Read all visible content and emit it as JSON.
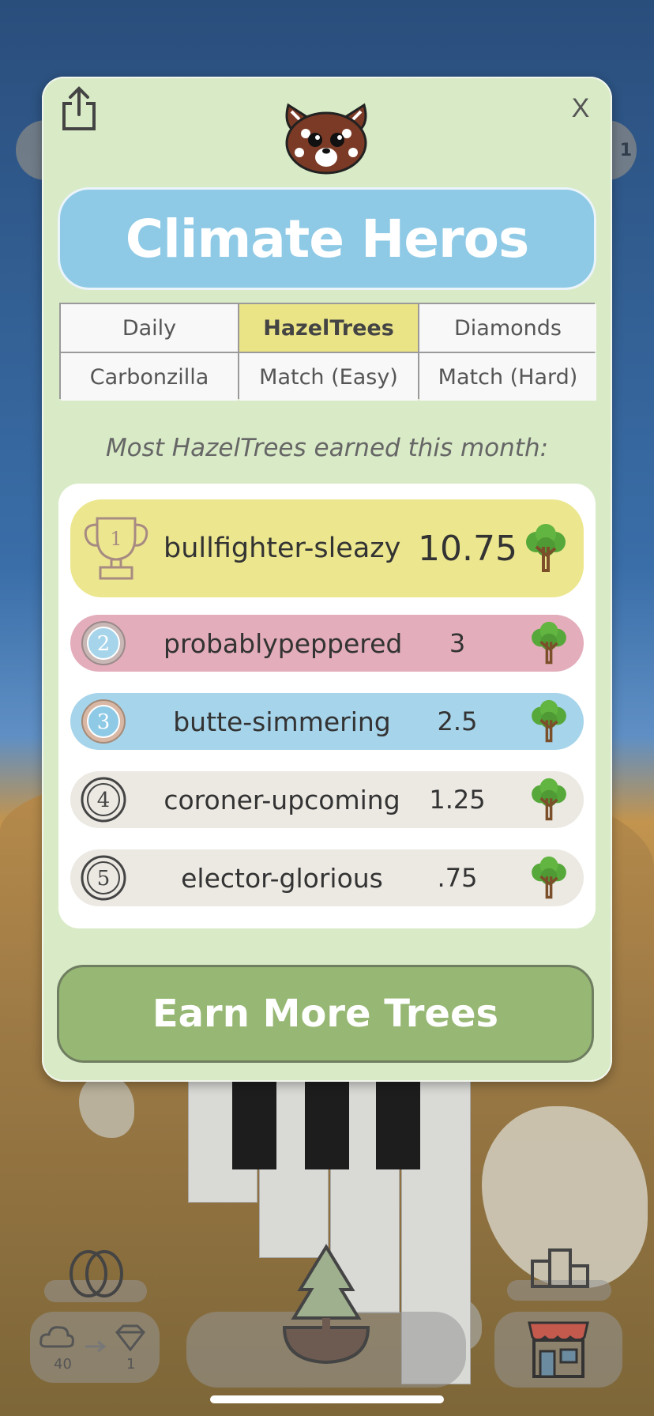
{
  "modal": {
    "title": "Climate Heros",
    "close_label": "X",
    "subtitle": "Most HazelTrees earned this month:",
    "tabs": [
      {
        "label": "Daily",
        "active": false
      },
      {
        "label": "HazelTrees",
        "active": true
      },
      {
        "label": "Diamonds",
        "active": false
      },
      {
        "label": "Carbonzilla",
        "active": false
      },
      {
        "label": "Match (Easy)",
        "active": false
      },
      {
        "label": "Match (Hard)",
        "active": false
      }
    ],
    "leaderboard": [
      {
        "rank": "1",
        "name": "bullfighter-sleazy",
        "score": "10.75"
      },
      {
        "rank": "2",
        "name": "probablypeppered",
        "score": "3"
      },
      {
        "rank": "3",
        "name": "butte-simmering",
        "score": "2.5"
      },
      {
        "rank": "4",
        "name": "coroner-upcoming",
        "score": "1.25"
      },
      {
        "rank": "5",
        "name": "elector-glorious",
        "score": ".75"
      }
    ],
    "cta_label": "Earn More Trees"
  },
  "background": {
    "side_badge_number": "1",
    "exchange": {
      "cloud_amount": "40",
      "diamond_amount": "1"
    }
  },
  "colors": {
    "modal_bg": "#d8eac6",
    "title_pill": "#8ecae6",
    "active_tab": "#ebe487",
    "gold_row": "#ece78f",
    "silver_row": "#e3adbb",
    "bronze_row": "#a6d4ea",
    "plain_row": "#ece9e3",
    "cta": "#97b874"
  },
  "icons": {
    "share": "share-icon",
    "mascot": "red-panda-icon",
    "trophy": "trophy-icon",
    "medal": "medal-icon",
    "tree": "tree-icon",
    "eggs": "eggs-icon",
    "cloud": "cloud-icon",
    "diamond": "diamond-icon",
    "trees": "pine-trees-icon",
    "podium": "podium-icon",
    "shop": "shop-icon"
  }
}
